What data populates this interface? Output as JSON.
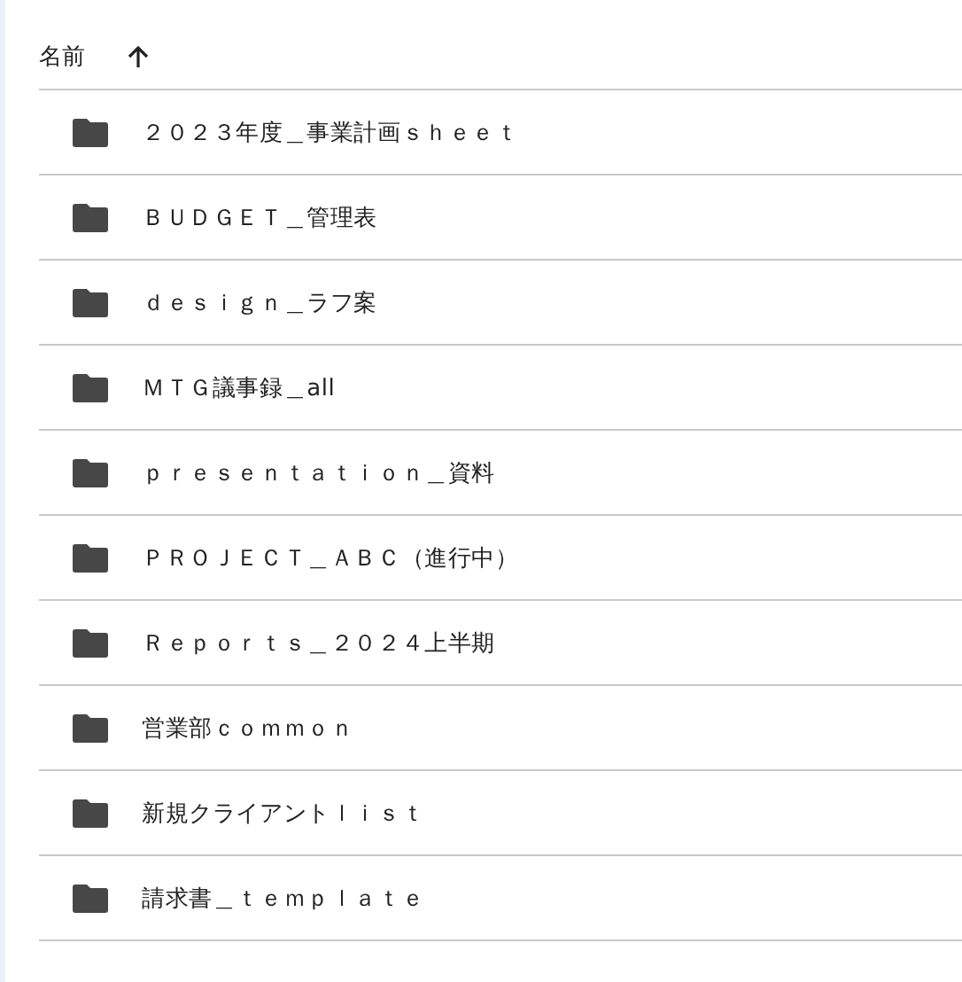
{
  "header": {
    "label": "名前"
  },
  "files": [
    {
      "name": "２０２３年度＿事業計画ｓｈｅｅｔ"
    },
    {
      "name": "ＢＵＤＧＥＴ＿管理表"
    },
    {
      "name": "ｄｅｓｉｇｎ＿ラフ案"
    },
    {
      "name": "ＭＴＧ議事録＿all"
    },
    {
      "name": "ｐｒｅｓｅｎｔａｔｉｏｎ＿資料"
    },
    {
      "name": "ＰＲＯＪＥＣＴ＿ＡＢＣ（進行中）"
    },
    {
      "name": "Ｒｅｐｏｒｔｓ＿２０２４上半期"
    },
    {
      "name": "営業部ｃｏｍｍｏｎ"
    },
    {
      "name": "新規クライアントｌｉｓｔ"
    },
    {
      "name": "請求書＿ｔｅｍｐｌａｔｅ"
    }
  ]
}
